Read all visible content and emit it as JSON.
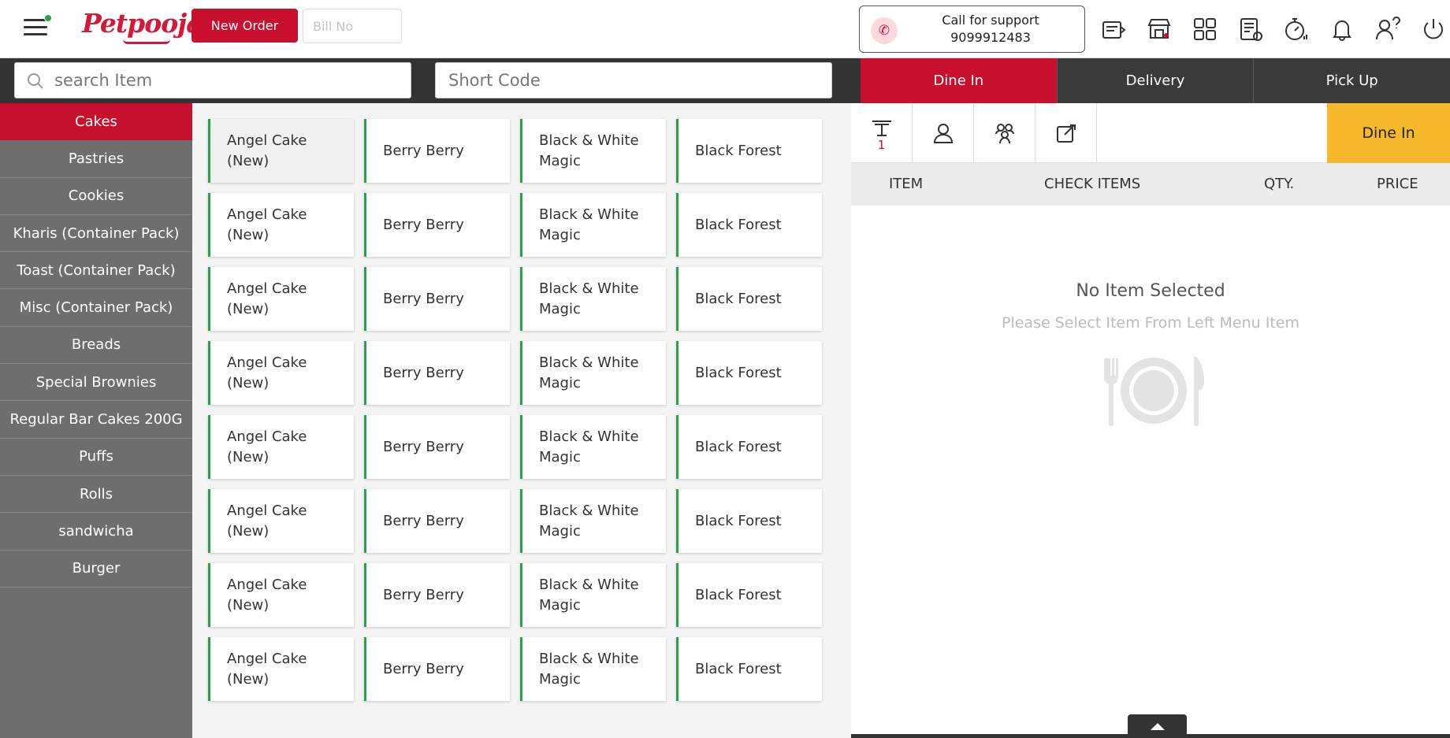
{
  "header": {
    "brand": "Petpooja",
    "new_order_label": "New Order",
    "bill_no_placeholder": "Bill No",
    "support_label": "Call for support",
    "support_phone": "9099912483",
    "icons": [
      "restaurant-icon",
      "store-icon",
      "dashboard-icon",
      "report-icon",
      "timer-icon",
      "bell-icon",
      "help-icon",
      "power-icon"
    ]
  },
  "search": {
    "item_placeholder": "search Item",
    "short_code_placeholder": "Short Code"
  },
  "order_types": [
    "Dine In",
    "Delivery",
    "Pick Up"
  ],
  "active_order_type": "Dine In",
  "categories": [
    "Cakes",
    "Pastries",
    "Cookies",
    "Kharis (Container Pack)",
    "Toast (Container Pack)",
    "Misc (Container Pack)",
    "Breads",
    "Special Brownies",
    "Regular Bar Cakes 200G",
    "Puffs",
    "Rolls",
    "sandwicha",
    "Burger"
  ],
  "active_category": "Cakes",
  "items": [
    [
      "Angel Cake (New)",
      "Berry Berry",
      "Black & White Magic",
      "Black Forest"
    ],
    [
      "Angel Cake (New)",
      "Berry Berry",
      "Black & White Magic",
      "Black Forest"
    ],
    [
      "Angel Cake (New)",
      "Berry Berry",
      "Black & White Magic",
      "Black Forest"
    ],
    [
      "Angel Cake (New)",
      "Berry Berry",
      "Black & White Magic",
      "Black Forest"
    ],
    [
      "Angel Cake (New)",
      "Berry Berry",
      "Black & White Magic",
      "Black Forest"
    ],
    [
      "Angel Cake (New)",
      "Berry Berry",
      "Black & White Magic",
      "Black Forest"
    ],
    [
      "Angel Cake (New)",
      "Berry Berry",
      "Black & White Magic",
      "Black Forest"
    ],
    [
      "Angel Cake (New)",
      "Berry Berry",
      "Black & White Magic",
      "Black Forest"
    ]
  ],
  "panel": {
    "table_count": "1",
    "order_badge": "Dine In",
    "columns": [
      "ITEM",
      "CHECK ITEMS",
      "QTY.",
      "PRICE"
    ],
    "empty_title": "No Item Selected",
    "empty_subtitle": "Please Select Item From Left Menu Item"
  },
  "colors": {
    "brand_red": "#c8102e",
    "accent_yellow": "#f6b92b",
    "item_border_green": "#2e9f4d",
    "sidebar_gray": "#6e6e6e",
    "dark_bar": "#333333"
  }
}
